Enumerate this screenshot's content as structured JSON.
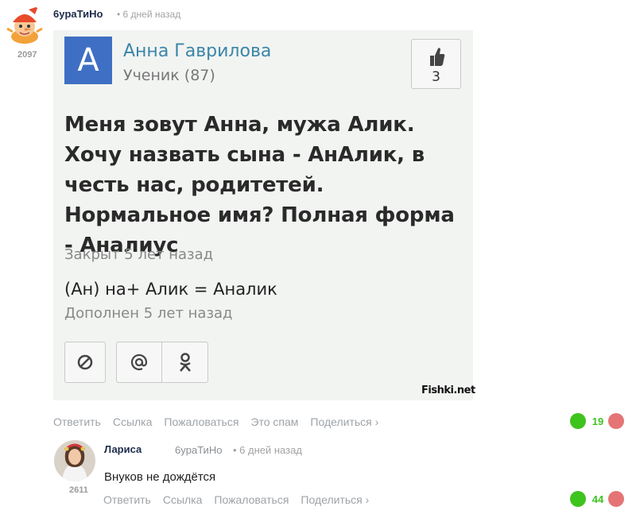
{
  "comment": {
    "author": "6yраТиНо",
    "time": "• 6 дней назад",
    "rating": "2097",
    "card": {
      "avatar_letter": "А",
      "name": "Анна Гаврилова",
      "rank": "Ученик (87)",
      "likes": "3",
      "question": "Меня зовут Анна, мужа Алик. Хочу назвать сына - АнАлик, в честь нас, родитетей. Нормальное имя? Полная форма - Аналиус",
      "closed": "Закрыт 5 лет назад",
      "answer": "(Ан) на+ Алик = Аналик",
      "added": "Дополнен 5 лет назад",
      "watermark": "Fishki.net"
    },
    "actions": [
      "Ответить",
      "Ссылка",
      "Пожаловаться",
      "Это спам",
      "Поделиться ›"
    ],
    "votes": "19"
  },
  "reply": {
    "author": "Лариса",
    "reply_to": "6yраТиНо",
    "time": "• 6 дней назад",
    "rating": "2611",
    "text": "Внуков не дождётся",
    "actions": [
      "Ответить",
      "Ссылка",
      "Пожаловаться",
      "Поделиться ›"
    ],
    "votes": "44"
  },
  "colors": {
    "vote_up": "#3fc31f",
    "vote_down": "#e57575",
    "author": "#1e2a4a",
    "meta": "#9ea3a8"
  }
}
